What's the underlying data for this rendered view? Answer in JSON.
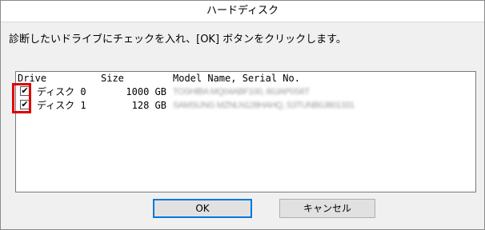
{
  "window": {
    "title": "ハードディスク"
  },
  "instruction": "診断したいドライブにチェックを入れ、[OK] ボタンをクリックします。",
  "list": {
    "headers": {
      "drive": "Drive",
      "size": "Size",
      "model": "Model Name, Serial No."
    },
    "rows": [
      {
        "checked": true,
        "check_glyph": "✔",
        "name": "ディスク 0",
        "size": "1000 GB",
        "model": "TOSHIBA MQ04ABF100, 60JAP0S6T"
      },
      {
        "checked": true,
        "check_glyph": "✔",
        "name": "ディスク 1",
        "size": "128 GB",
        "model": "SAMSUNG MZNLN128HAHQ, S3TUNB0J801331"
      }
    ]
  },
  "buttons": {
    "ok": "OK",
    "cancel": "キャンセル"
  },
  "colors": {
    "highlight": "#e00000",
    "focus": "#0078d7"
  }
}
